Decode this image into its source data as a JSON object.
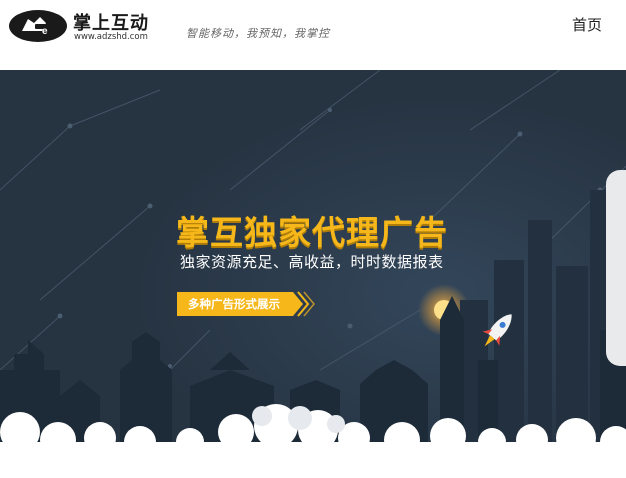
{
  "header": {
    "logo_name": "掌上互动",
    "logo_url": "www.adzshd.com",
    "slogan": "智能移动，我预知，我掌控",
    "nav_home": "首页"
  },
  "banner": {
    "title": "掌互独家代理广告",
    "subtitle": "独家资源充足、高收益，时时数据报表",
    "cta_label": "多种广告形式展示"
  },
  "colors": {
    "banner_bg": "#2a3847",
    "title_accent": "#f5b719",
    "cta_bg": "#f5b719",
    "side_panel": "#e9eaec"
  },
  "icons": [
    "logo-hand-icon",
    "rocket-icon",
    "sun-icon",
    "arrow-chevron-icon"
  ]
}
